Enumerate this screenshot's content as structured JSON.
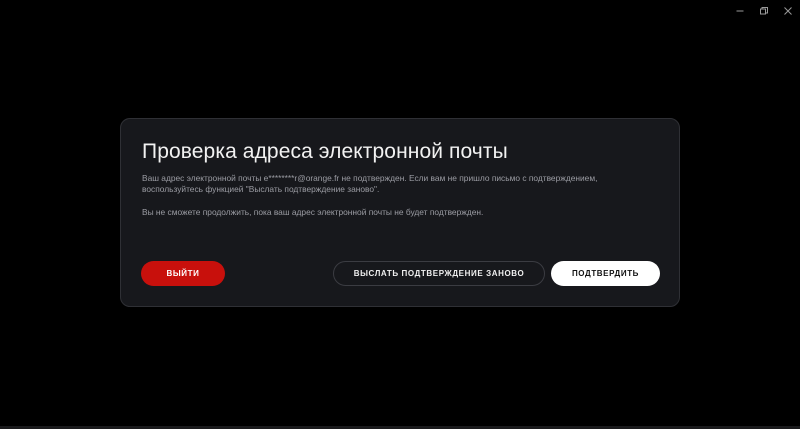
{
  "window": {
    "controls": [
      {
        "name": "minimize-icon"
      },
      {
        "name": "restore-icon"
      },
      {
        "name": "close-icon"
      }
    ]
  },
  "dialog": {
    "title": "Проверка адреса электронной почты",
    "message_1": "Ваш адрес электронной почты e********r@orange.fr не подтвержден. Если вам не пришло письмо с подтверждением, воспользуйтесь функцией \"Выслать подтверждение заново\".",
    "message_2": "Вы не сможете продолжить, пока ваш адрес электронной почты не будет подтвержден.",
    "buttons": {
      "exit": "ВЫЙТИ",
      "resend": "ВЫСЛАТЬ ПОДТВЕРЖДЕНИЕ ЗАНОВО",
      "confirm": "ПОДТВЕРДИТЬ"
    }
  },
  "colors": {
    "background": "#000000",
    "dialog_bg": "#17181c",
    "accent_red": "#c8100c",
    "confirm_bg": "#ffffff"
  }
}
